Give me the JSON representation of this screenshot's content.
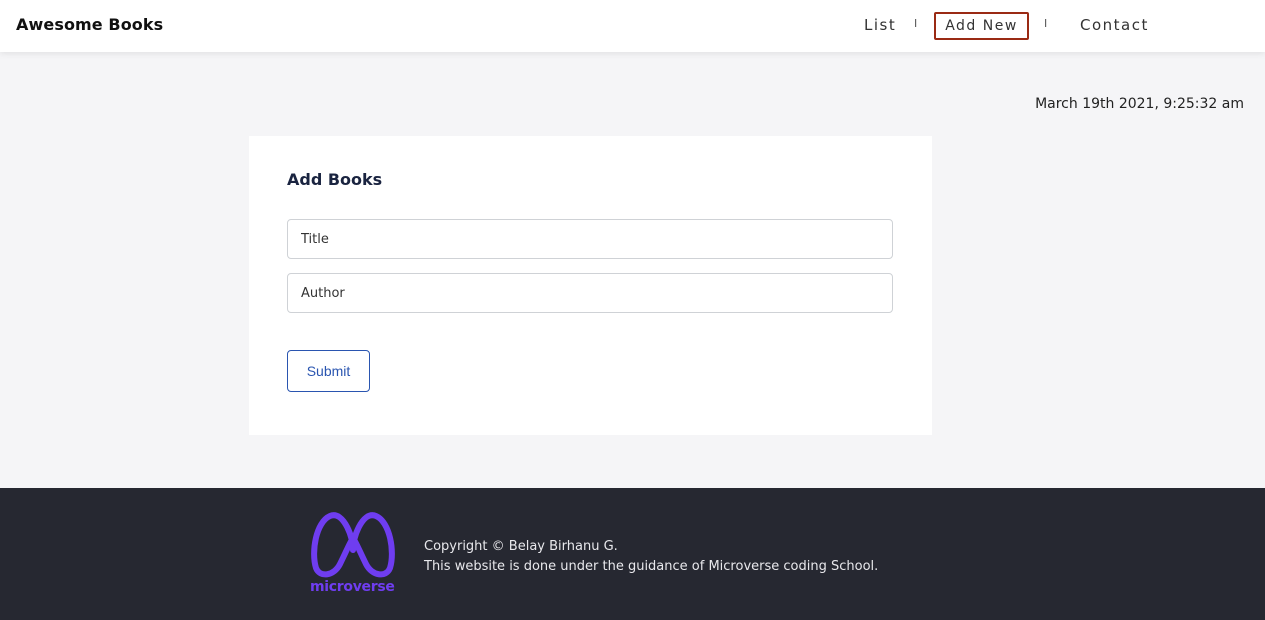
{
  "header": {
    "brand": "Awesome Books",
    "nav": {
      "list": "List",
      "separator": "I",
      "add_new": "Add New",
      "contact": "Contact"
    },
    "active_outline_color": "#9a2a14"
  },
  "timestamp": "March 19th 2021, 9:25:32 am",
  "form": {
    "heading": "Add Books",
    "title_placeholder": "Title",
    "author_placeholder": "Author",
    "title_value": "",
    "author_value": "",
    "submit_label": "Submit",
    "submit_color": "#2a55b0"
  },
  "footer": {
    "logo_text": "microverse",
    "logo_color": "#6f3df0",
    "copyright": "Copyright © Belay Birhanu G.",
    "credit": "This website is done under the guidance of Microverse coding School."
  }
}
